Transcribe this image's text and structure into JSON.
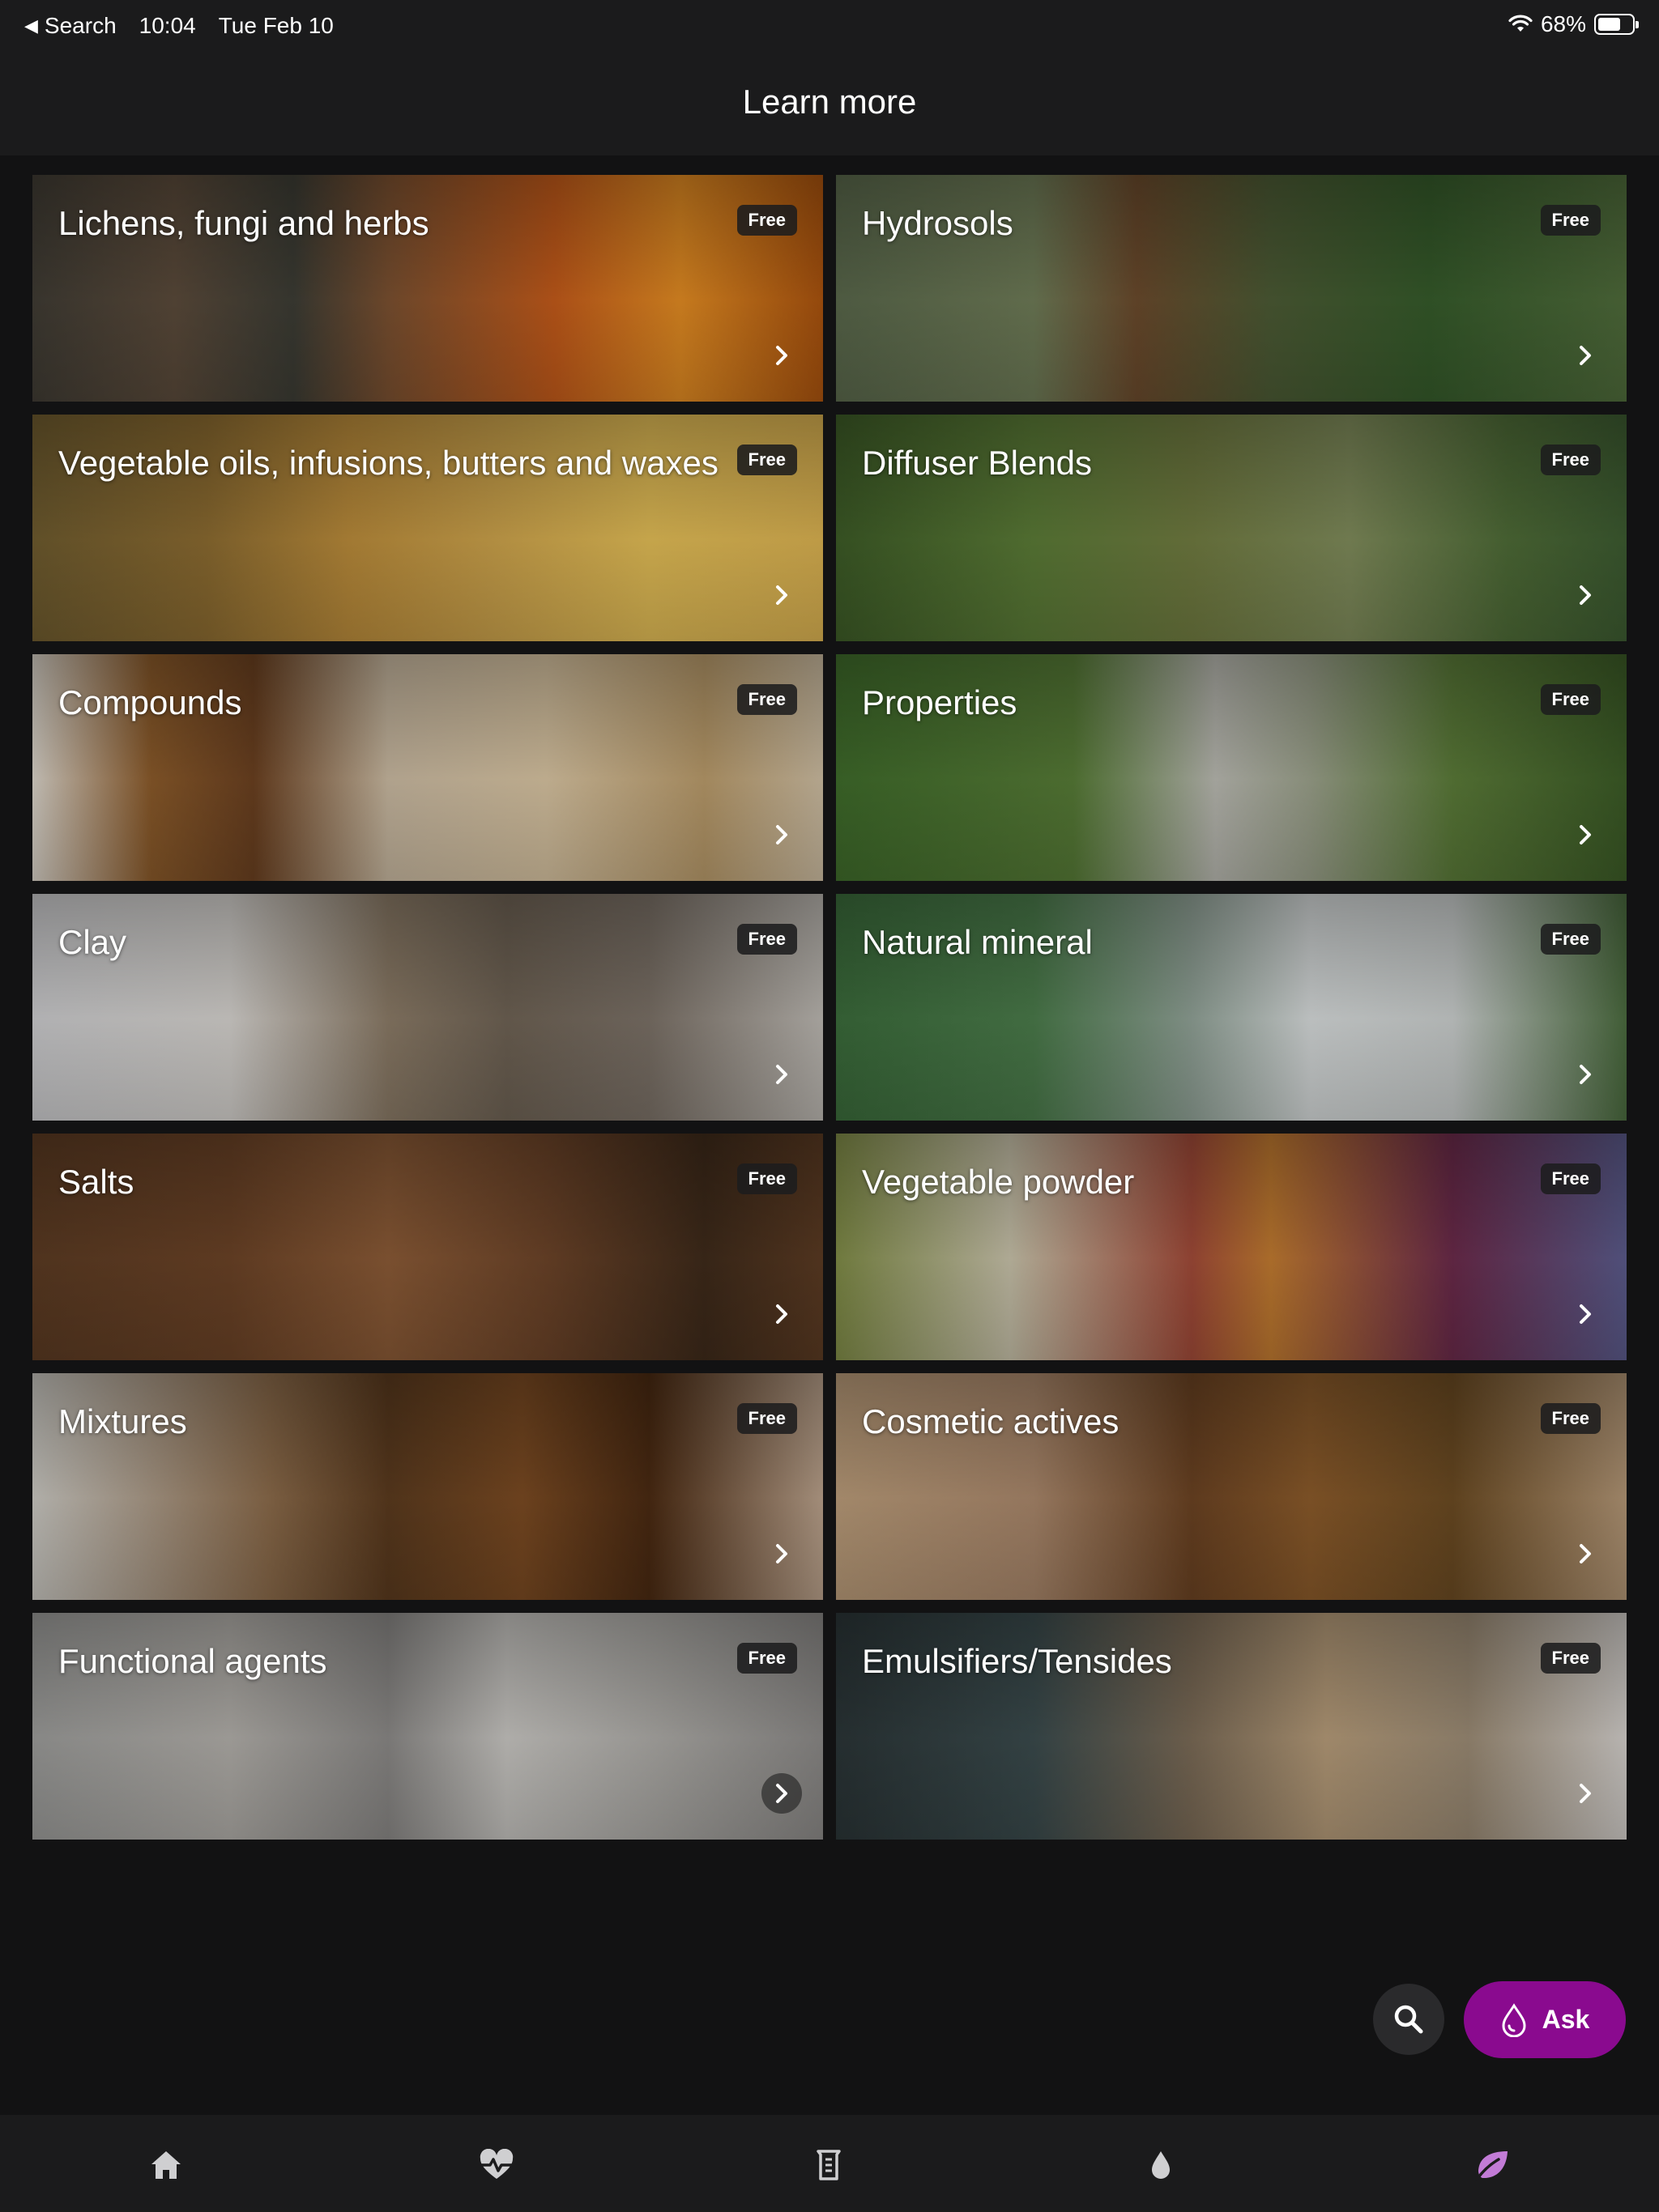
{
  "status_bar": {
    "back_label": "Search",
    "time": "10:04",
    "date": "Tue Feb 10",
    "battery": "68%",
    "battery_level": 0.68
  },
  "header": {
    "title": "Learn more"
  },
  "colors": {
    "accent": "#8a0a8f",
    "background": "#121213",
    "bar": "#1b1b1c"
  },
  "cards": [
    {
      "title": "Lichens, fungi and herbs",
      "badge": "Free"
    },
    {
      "title": "Hydrosols",
      "badge": "Free"
    },
    {
      "title": "Vegetable oils, infusions, butters and waxes",
      "badge": "Free"
    },
    {
      "title": "Diffuser Blends",
      "badge": "Free"
    },
    {
      "title": "Compounds",
      "badge": "Free"
    },
    {
      "title": "Properties",
      "badge": "Free"
    },
    {
      "title": "Clay",
      "badge": "Free"
    },
    {
      "title": "Natural mineral",
      "badge": "Free"
    },
    {
      "title": "Salts",
      "badge": "Free"
    },
    {
      "title": "Vegetable powder",
      "badge": "Free"
    },
    {
      "title": "Mixtures",
      "badge": "Free"
    },
    {
      "title": "Cosmetic actives",
      "badge": "Free"
    },
    {
      "title": "Functional agents",
      "badge": "Free"
    },
    {
      "title": "Emulsifiers/Tensides",
      "badge": "Free"
    }
  ],
  "fab": {
    "ask_label": "Ask",
    "search_icon": "search-icon",
    "ask_icon": "drop-icon"
  },
  "tab_bar": {
    "items": [
      {
        "icon": "home-icon",
        "active": false
      },
      {
        "icon": "heart-pulse-icon",
        "active": false
      },
      {
        "icon": "beaker-icon",
        "active": false
      },
      {
        "icon": "drop-icon",
        "active": false
      },
      {
        "icon": "leaf-icon",
        "active": true
      }
    ]
  }
}
